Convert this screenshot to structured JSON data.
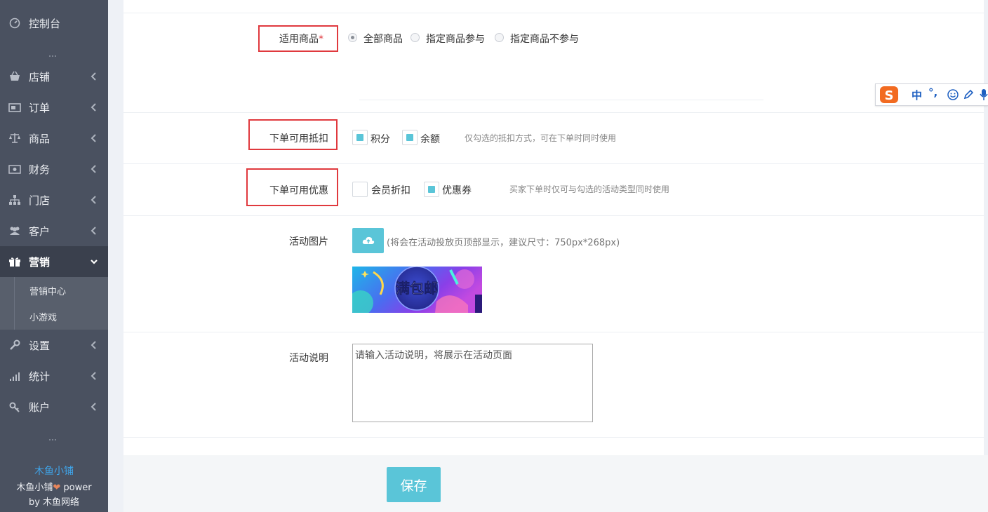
{
  "sidebar": {
    "items": [
      {
        "label": "控制台",
        "icon": "dashboard-icon"
      },
      {
        "label": "店铺",
        "icon": "shop-icon"
      },
      {
        "label": "订单",
        "icon": "order-icon"
      },
      {
        "label": "商品",
        "icon": "scale-icon"
      },
      {
        "label": "财务",
        "icon": "money-icon"
      },
      {
        "label": "门店",
        "icon": "sitemap-icon"
      },
      {
        "label": "客户",
        "icon": "users-icon"
      },
      {
        "label": "营销",
        "icon": "gift-icon"
      },
      {
        "label": "设置",
        "icon": "wrench-icon"
      },
      {
        "label": "统计",
        "icon": "signal-icon"
      },
      {
        "label": "账户",
        "icon": "key-icon"
      }
    ],
    "active": "营销",
    "subitems": [
      {
        "label": "营销中心"
      },
      {
        "label": "小游戏"
      }
    ],
    "footer": {
      "brand": "木鱼小铺",
      "power_prefix": "木鱼小铺",
      "power_suffix": " power",
      "by": "by 木鱼网络"
    }
  },
  "form": {
    "goods_scope": {
      "label": "适用商品",
      "required_mark": "*",
      "options": [
        "全部商品",
        "指定商品参与",
        "指定商品不参与"
      ],
      "selected": "全部商品"
    },
    "deduction": {
      "label": "下单可用抵扣",
      "options": [
        {
          "label": "积分",
          "checked": true
        },
        {
          "label": "余额",
          "checked": true
        }
      ],
      "hint": "仅勾选的抵扣方式，可在下单时同时使用"
    },
    "discount": {
      "label": "下单可用优惠",
      "options": [
        {
          "label": "会员折扣",
          "checked": false
        },
        {
          "label": "优惠券",
          "checked": true
        }
      ],
      "hint": "买家下单时仅可与勾选的活动类型同时使用"
    },
    "image": {
      "label": "活动图片",
      "hint": "(将会在活动投放页顶部显示，建议尺寸：750px*268px)",
      "banner_text": "满包邮"
    },
    "description": {
      "label": "活动说明",
      "placeholder": "请输入活动说明，将展示在活动页面"
    },
    "save_label": "保存"
  },
  "ime": {
    "mode": "中",
    "punct": "°,"
  },
  "colors": {
    "accent": "#5ac5d8",
    "highlight_box": "#e0393e",
    "sidebar_bg": "#4a5160"
  }
}
